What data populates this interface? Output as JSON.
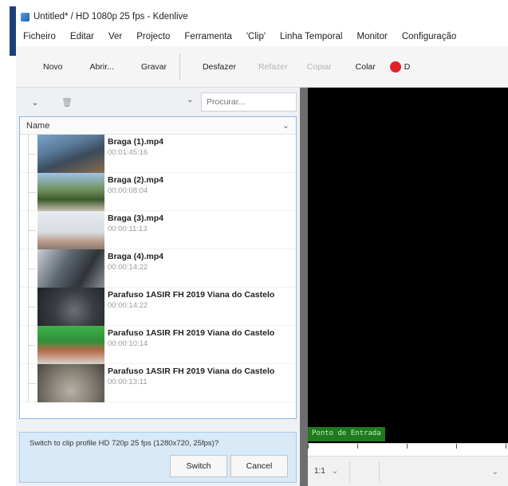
{
  "window": {
    "title": "Untitled* / HD 1080p 25 fps - Kdenlive"
  },
  "menu": [
    "Ficheiro",
    "Editar",
    "Ver",
    "Projecto",
    "Ferramenta",
    "'Clip'",
    "Linha Temporal",
    "Monitor",
    "Configuração"
  ],
  "toolbar": {
    "novo": "Novo",
    "abrir": "Abrir...",
    "gravar": "Gravar",
    "desfazer": "Desfazer",
    "refazer": "Refazer",
    "copiar": "Copiar",
    "colar": "Colar",
    "record_label": "D"
  },
  "bin": {
    "search_placeholder": "Procurar...",
    "column_header": "Name",
    "clips": [
      {
        "name": "Braga (1).mp4",
        "duration": "00:01:45:16"
      },
      {
        "name": "Braga (2).mp4",
        "duration": "00:00:08:04"
      },
      {
        "name": "Braga (3).mp4",
        "duration": "00:00:11:13"
      },
      {
        "name": "Braga (4).mp4",
        "duration": "00:00:14:22"
      },
      {
        "name": "Parafuso 1ASIR FH 2019 Viana do Castelo",
        "duration": "00:00:14:22"
      },
      {
        "name": "Parafuso 1ASIR FH 2019 Viana do Castelo",
        "duration": "00:00:10:14"
      },
      {
        "name": "Parafuso 1ASIR FH 2019 Viana do Castelo",
        "duration": "00:00:13:11"
      }
    ]
  },
  "notification": {
    "message": "Switch to clip profile HD 720p 25 fps (1280x720, 25fps)?",
    "switch_label": "Switch",
    "cancel_label": "Cancel"
  },
  "monitor": {
    "in_point_label": "Ponto de Entrada",
    "zoom": "1:1"
  }
}
